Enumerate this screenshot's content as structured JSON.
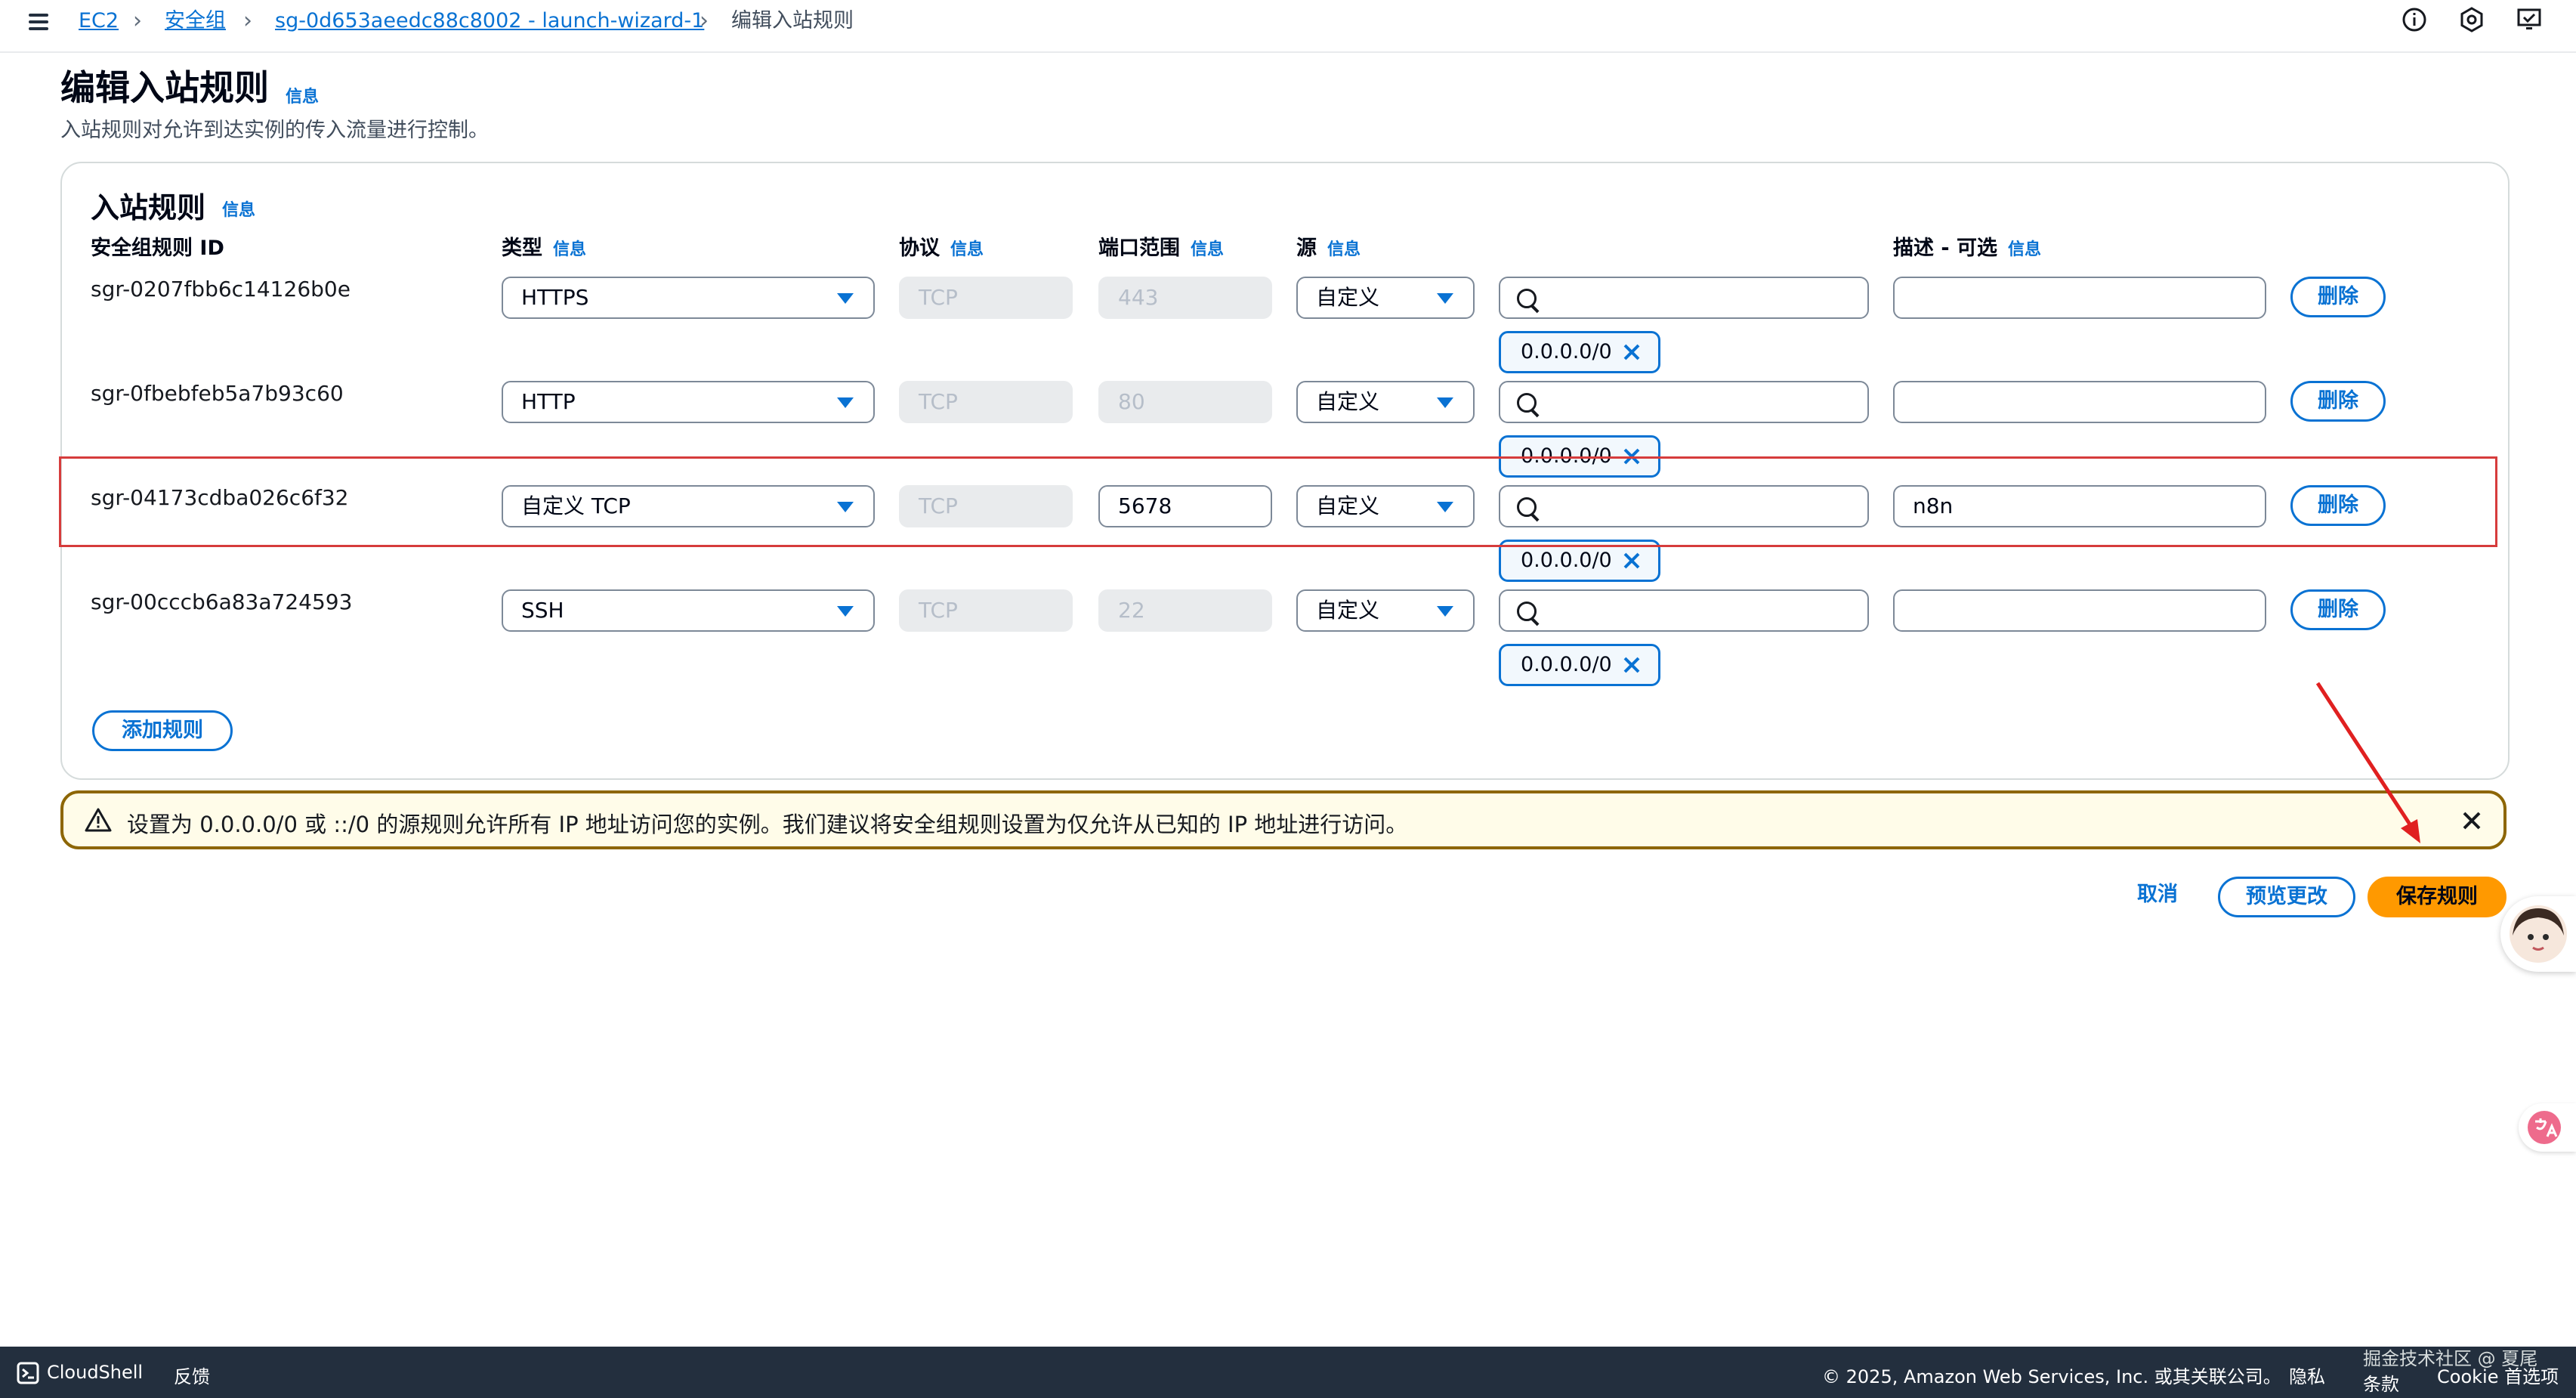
{
  "breadcrumb": {
    "items": [
      "EC2",
      "安全组",
      "sg-0d653aeedc88c8002 - launch-wizard-1"
    ],
    "current": "编辑入站规则"
  },
  "page": {
    "title": "编辑入站规则",
    "info": "信息",
    "description": "入站规则对允许到达实例的传入流量进行控制。"
  },
  "panel": {
    "title": "入站规则",
    "info": "信息",
    "columns": {
      "rule_id": "安全组规则 ID",
      "type": "类型",
      "protocol": "协议",
      "port": "端口范围",
      "source": "源",
      "description": "描述 - 可选",
      "info": "信息"
    },
    "rules": [
      {
        "id": "sgr-0207fbb6c14126b0e",
        "type": "HTTPS",
        "protocol": "TCP",
        "port": "443",
        "source_type": "自定义",
        "source_search": "",
        "cidr": "0.0.0.0/0",
        "description": "",
        "delete": "删除"
      },
      {
        "id": "sgr-0fbebfeb5a7b93c60",
        "type": "HTTP",
        "protocol": "TCP",
        "port": "80",
        "source_type": "自定义",
        "source_search": "",
        "cidr": "0.0.0.0/0",
        "description": "",
        "delete": "删除"
      },
      {
        "id": "sgr-04173cdba026c6f32",
        "type": "自定义 TCP",
        "protocol": "TCP",
        "port": "5678",
        "source_type": "自定义",
        "source_search": "",
        "cidr": "0.0.0.0/0",
        "description": "n8n",
        "delete": "删除"
      },
      {
        "id": "sgr-00cccb6a83a724593",
        "type": "SSH",
        "protocol": "TCP",
        "port": "22",
        "source_type": "自定义",
        "source_search": "",
        "cidr": "0.0.0.0/0",
        "description": "",
        "delete": "删除"
      }
    ],
    "add_rule": "添加规则"
  },
  "alert": {
    "text": "设置为 0.0.0.0/0 或 ::/0 的源规则允许所有 IP 地址访问您的实例。我们建议将安全组规则设置为仅允许从已知的 IP 地址进行访问。"
  },
  "actions": {
    "cancel": "取消",
    "preview": "预览更改",
    "save": "保存规则"
  },
  "footer": {
    "cloudshell": "CloudShell",
    "feedback": "反馈",
    "copyright": "© 2025, Amazon Web Services, Inc. 或其关联公司。",
    "privacy": "隐私",
    "terms": "条款",
    "cookie": "Cookie 首选项",
    "watermark": "掘金技术社区 @ 夏尾"
  },
  "colors": {
    "accent": "#0972d3",
    "primary_button": "#ff9900",
    "warning_border": "#8d6605",
    "highlight_box": "#d63c3c",
    "annotation_arrow": "#e02020"
  }
}
